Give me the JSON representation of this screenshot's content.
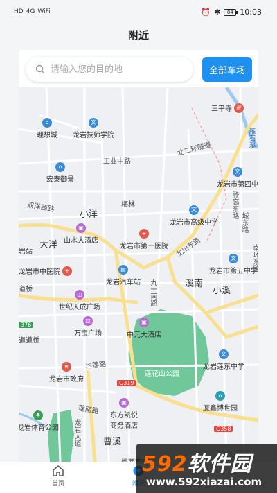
{
  "status_bar": {
    "left_indicators": [
      "HD",
      "4G",
      "WiFi"
    ],
    "time": "10:03",
    "battery": "84"
  },
  "header": {
    "title": "附近"
  },
  "search": {
    "placeholder": "请输入您的目的地",
    "all_parking_label": "全部车场"
  },
  "map": {
    "pois": [
      {
        "name": "三平寺",
        "icon": "temple-icon",
        "color": "red"
      },
      {
        "name": "理想城",
        "icon": "building-icon",
        "color": "blue"
      },
      {
        "name": "龙岩技师学院",
        "icon": "school-icon",
        "color": "blue"
      },
      {
        "name": "宏泰御景",
        "icon": "building-icon",
        "color": "blue"
      },
      {
        "name": "龙岩市第四中",
        "icon": "school-icon",
        "color": "blue"
      },
      {
        "name": "龙岩市高级中学",
        "icon": "school-icon",
        "color": "blue"
      },
      {
        "name": "山水大酒店",
        "icon": "hotel-icon",
        "color": "purple"
      },
      {
        "name": "龙岩市第一医院",
        "icon": "hospital-icon",
        "color": "red"
      },
      {
        "name": "龙岩市中医院",
        "icon": "hospital-icon",
        "color": "red"
      },
      {
        "name": "龙岩汽车站",
        "icon": "bus-icon",
        "color": "blue"
      },
      {
        "name": "龙岩市第五中学",
        "icon": "school-icon",
        "color": "blue"
      },
      {
        "name": "世纪天成广场",
        "icon": "shopping-icon",
        "color": "purple"
      },
      {
        "name": "万宝广场",
        "icon": "shopping-icon",
        "color": "purple"
      },
      {
        "name": "中元大酒店",
        "icon": "hotel-icon",
        "color": "purple"
      },
      {
        "name": "龙岩市政府",
        "icon": "government-icon",
        "color": "red"
      },
      {
        "name": "龙岩莲东中学",
        "icon": "school-icon",
        "color": "blue"
      },
      {
        "name": "龙岩体育公园",
        "icon": "park-icon",
        "color": "green"
      },
      {
        "name": "东方凯悦\n商务酒店",
        "icon": "hotel-icon",
        "color": "purple"
      },
      {
        "name": "厦鑫博世园",
        "icon": "building-icon",
        "color": "teal"
      }
    ],
    "labels": {
      "road_north2": "北二环隧道",
      "road_industry": "工业中路",
      "district_xiaoyang": "小洋",
      "district_dayang": "大洋",
      "road_shuangyang": "双洋西路",
      "area_meilin": "梅林",
      "road_longchuan": "龙川东路",
      "district_xinan": "溪南",
      "district_xiaoxi": "小溪",
      "road_jiuyi": "九一南路",
      "road_hualian": "华莲路",
      "road_lianan": "莲南路",
      "area_caoxi": "曹溪",
      "road_longyan": "龙岩大道",
      "park_lianhuashan": "莲花山公园",
      "road_denggao": "登高东路",
      "road_chengdong": "城东路",
      "road_nanhuan": "南环东路",
      "road_yanshi": "雁石溪",
      "area_daodaoqiao": "道桥",
      "area_daodao": "道道桥",
      "area_qiaozhan": "站",
      "station_left": "岩站",
      "badge_g319": "G319",
      "badge_g358": "G358",
      "badge_376": "376",
      "hotel_bottom": "闽西宾馆"
    }
  },
  "bottom_nav": {
    "items": [
      {
        "label": "首页",
        "icon": "home-icon"
      },
      {
        "label": "附近",
        "icon": "location-icon"
      }
    ]
  },
  "watermark": {
    "logo_num": "592",
    "logo_text": "软件园",
    "url": "www.592xiazai.com"
  },
  "colors": {
    "accent": "#1e90ef",
    "map_bg": "#eef0f3",
    "park": "#6fc79a",
    "main_road": "#f8e08e"
  }
}
